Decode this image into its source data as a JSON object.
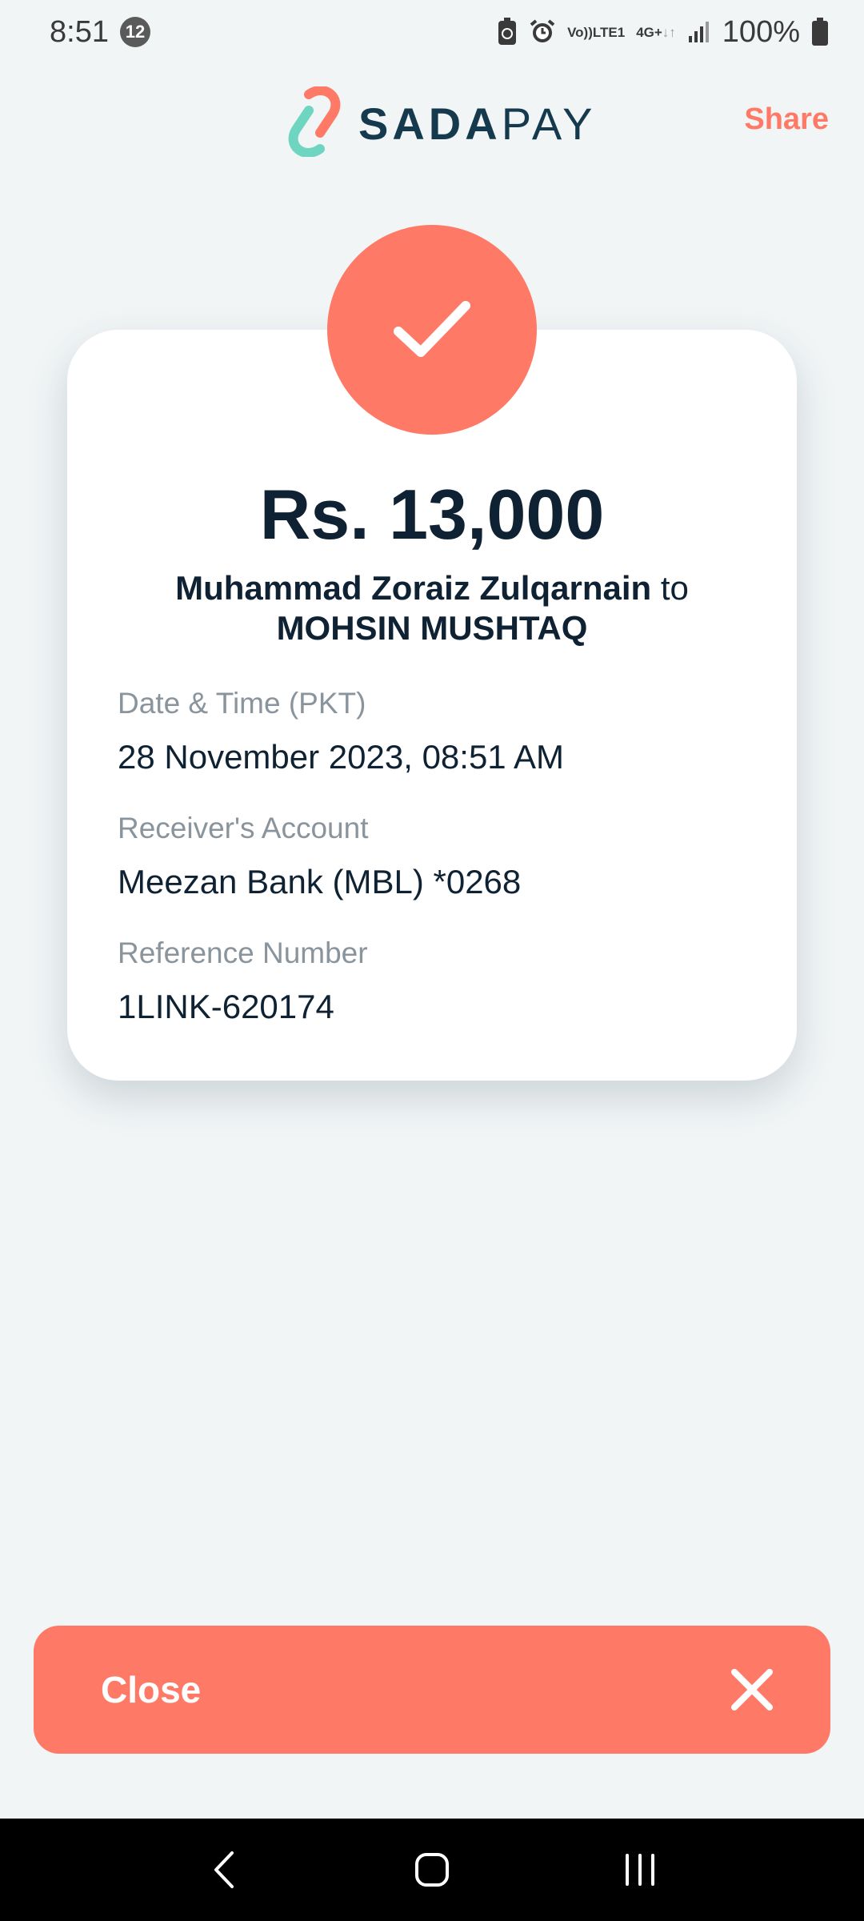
{
  "status_bar": {
    "time": "8:51",
    "notification_count": "12",
    "network_volte": "Vo))",
    "network_lte": "LTE1",
    "network_4g": "4G+",
    "battery": "100%"
  },
  "header": {
    "logo_bold": "SADA",
    "logo_light": "PAY",
    "share_label": "Share"
  },
  "receipt": {
    "amount": "Rs. 13,000",
    "sender": "Muhammad Zoraiz Zulqarnain",
    "connector": " to",
    "receiver": "MOHSIN MUSHTAQ",
    "fields": [
      {
        "label": "Date & Time (PKT)",
        "value": "28 November 2023, 08:51 AM"
      },
      {
        "label": "Receiver's Account",
        "value": "Meezan Bank (MBL) *0268"
      },
      {
        "label": "Reference Number",
        "value": "1LINK-620174"
      }
    ]
  },
  "actions": {
    "close_label": "Close"
  },
  "colors": {
    "accent": "#ff7a66",
    "brand_dark": "#153a4e",
    "background": "#f1f5f6"
  },
  "icons": [
    "sadapay-logo-icon",
    "checkmark-icon",
    "close-icon",
    "back-nav-icon",
    "home-nav-icon",
    "recents-nav-icon"
  ]
}
